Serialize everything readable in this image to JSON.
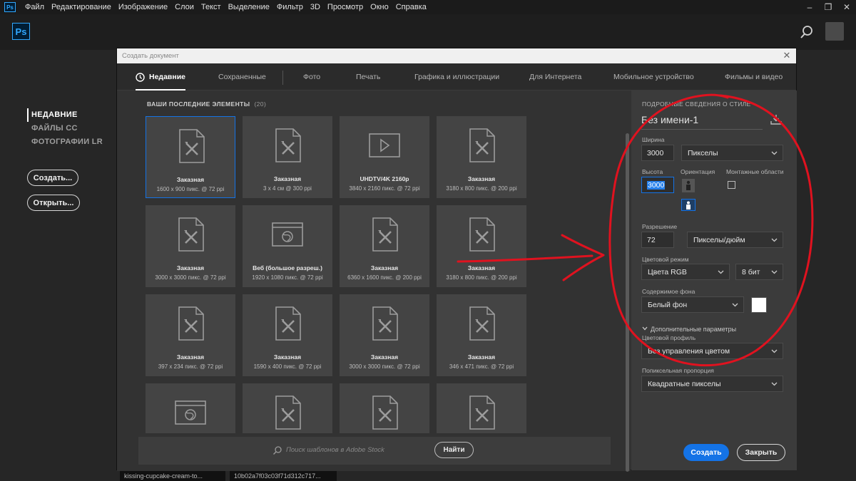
{
  "menubar": {
    "app_icon": "Ps",
    "items": [
      "Файл",
      "Редактирование",
      "Изображение",
      "Слои",
      "Текст",
      "Выделение",
      "Фильтр",
      "3D",
      "Просмотр",
      "Окно",
      "Справка"
    ],
    "window_controls": [
      "minimize-icon",
      "restore-icon",
      "close-icon"
    ]
  },
  "home": {
    "logo": "Ps",
    "nav": [
      "НЕДАВНИЕ",
      "ФАЙЛЫ CC",
      "ФОТОГРАФИИ LR"
    ],
    "create_button": "Создать...",
    "open_button": "Открыть...",
    "bottom_files": [
      "kissing-cupcake-cream-to...",
      "10b02a7f03c03f71d312c717..."
    ]
  },
  "dialog": {
    "title": "Создать документ",
    "tabs": [
      "Недавние",
      "Сохраненные",
      "Фото",
      "Печать",
      "Графика и иллюстрации",
      "Для Интернета",
      "Мобильное устройство",
      "Фильмы и видео"
    ],
    "recent_heading": "ВАШИ ПОСЛЕДНИЕ ЭЛЕМЕНТЫ",
    "recent_count": "(20)",
    "presets": [
      {
        "name": "Заказная",
        "meta": "1600 x 900 пикс. @ 72 ppi",
        "icon": "document-icon",
        "selected": true
      },
      {
        "name": "Заказная",
        "meta": "3 x 4 см @ 300 ppi",
        "icon": "document-icon"
      },
      {
        "name": "UHDTV/4K 2160p",
        "meta": "3840 x 2160 пикс. @ 72 ppi",
        "icon": "video-icon"
      },
      {
        "name": "Заказная",
        "meta": "3180 x 800 пикс. @ 200 ppi",
        "icon": "document-icon"
      },
      {
        "name": "Заказная",
        "meta": "3000 x 3000 пикс. @ 72 ppi",
        "icon": "document-icon"
      },
      {
        "name": "Веб (большое разреш.)",
        "meta": "1920 x 1080 пикс. @ 72 ppi",
        "icon": "web-icon"
      },
      {
        "name": "Заказная",
        "meta": "6360 x 1600 пикс. @ 200 ppi",
        "icon": "document-icon"
      },
      {
        "name": "Заказная",
        "meta": "3180 x 800 пикс. @ 200 ppi",
        "icon": "document-icon"
      },
      {
        "name": "Заказная",
        "meta": "397 x 234 пикс. @ 72 ppi",
        "icon": "document-icon"
      },
      {
        "name": "Заказная",
        "meta": "1590 x 400 пикс. @ 72 ppi",
        "icon": "document-icon"
      },
      {
        "name": "Заказная",
        "meta": "3000 x 3000 пикс. @ 72 ppi",
        "icon": "document-icon"
      },
      {
        "name": "Заказная",
        "meta": "346 x 471 пикс. @ 72 ppi",
        "icon": "document-icon"
      },
      {
        "name": "",
        "meta": "",
        "icon": "web-icon"
      },
      {
        "name": "",
        "meta": "",
        "icon": "document-icon"
      },
      {
        "name": "",
        "meta": "",
        "icon": "document-icon"
      },
      {
        "name": "",
        "meta": "",
        "icon": "document-icon"
      }
    ],
    "stock_placeholder": "Поиск шаблонов в Adobe Stock",
    "stock_button": "Найти"
  },
  "details": {
    "section_label": "ПОДРОБНЫЕ СВЕДЕНИЯ О СТИЛЕ",
    "doc_name": "Без имени-1",
    "width_label": "Ширина",
    "width_value": "3000",
    "width_unit": "Пикселы",
    "height_label": "Высота",
    "height_value": "3000",
    "orientation_label": "Ориентация",
    "artboards_label": "Монтажные области",
    "resolution_label": "Разрешение",
    "resolution_value": "72",
    "resolution_unit": "Пикселы/дюйм",
    "color_mode_label": "Цветовой режим",
    "color_mode_value": "Цвета RGB",
    "bit_depth_value": "8 бит",
    "background_label": "Содержимое фона",
    "background_value": "Белый фон",
    "background_color": "#ffffff",
    "advanced_label": "Дополнительные параметры",
    "profile_label": "Цветовой профиль",
    "profile_value": "Без управления цветом",
    "pixel_aspect_label": "Попиксельная пропорция",
    "pixel_aspect_value": "Квадратные пикселы",
    "create_button": "Создать",
    "close_button": "Закрыть"
  },
  "colors": {
    "accent": "#1473e6",
    "annotation": "#e0121f"
  }
}
